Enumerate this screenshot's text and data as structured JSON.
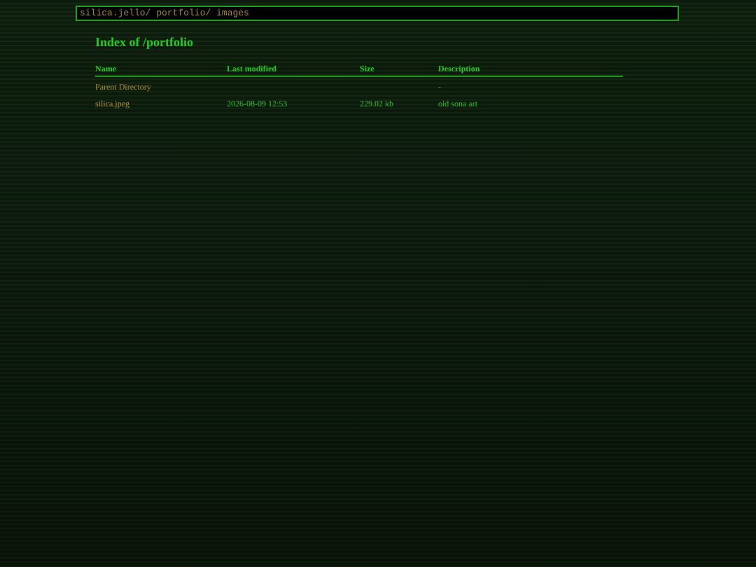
{
  "address_bar": {
    "value": "silica.jello/ portfolio/ images"
  },
  "heading": "Index of /portfolio",
  "table": {
    "columns": [
      "Name",
      "Last modified",
      "Size",
      "Description"
    ],
    "rows": [
      {
        "name": "Parent Directory",
        "description": "-"
      },
      {
        "name": "silica.jpeg",
        "last_modified": "2026-08-09 12:53",
        "size": "229.02 kb",
        "description": "old sona art"
      }
    ]
  }
}
